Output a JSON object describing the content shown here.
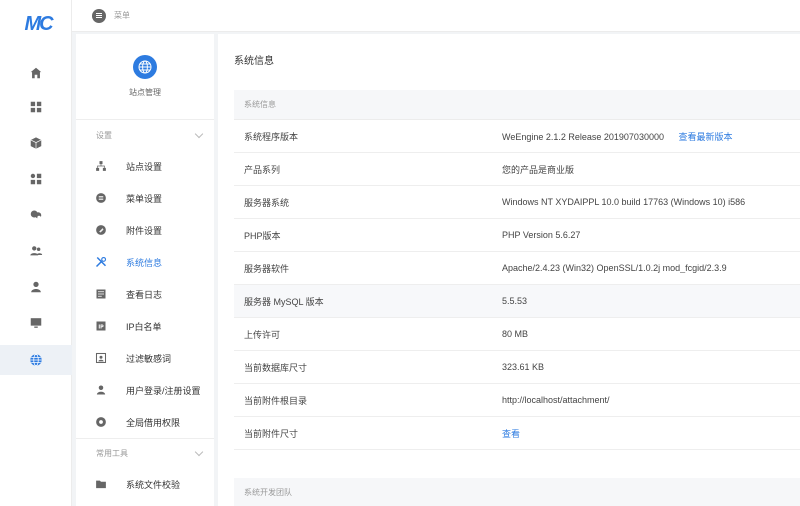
{
  "app": {
    "logo_text": "MC",
    "topbar_label": "菜单"
  },
  "rail": {
    "items": [
      {
        "icon": "home-icon"
      },
      {
        "icon": "grid-icon"
      },
      {
        "icon": "cube-icon"
      },
      {
        "icon": "apps-icon"
      },
      {
        "icon": "cloud-icon"
      },
      {
        "icon": "users-icon"
      },
      {
        "icon": "user-icon"
      },
      {
        "icon": "monitor-icon"
      },
      {
        "icon": "globe-icon",
        "active": true
      }
    ]
  },
  "subnav": {
    "site_title": "站点管理",
    "groups": [
      {
        "title": "设置",
        "items": [
          {
            "label": "站点设置",
            "icon": "sitemap-icon"
          },
          {
            "label": "菜单设置",
            "icon": "menu-circle-icon"
          },
          {
            "label": "附件设置",
            "icon": "paperclip-icon"
          },
          {
            "label": "系统信息",
            "icon": "tools-icon",
            "active": true
          },
          {
            "label": "查看日志",
            "icon": "log-icon"
          },
          {
            "label": "IP白名单",
            "icon": "ip-icon"
          },
          {
            "label": "过滤敏感词",
            "icon": "filter-icon"
          },
          {
            "label": "用户登录/注册设置",
            "icon": "user-icon"
          },
          {
            "label": "全局借用权限",
            "icon": "permission-icon"
          }
        ]
      },
      {
        "title": "常用工具",
        "items": [
          {
            "label": "系统文件校验",
            "icon": "folder-icon"
          }
        ]
      }
    ]
  },
  "main": {
    "page_title": "系统信息",
    "section_title": "系统信息",
    "footer_section_title": "系统开发团队",
    "rows": [
      {
        "key": "系统程序版本",
        "value": "WeEngine 2.1.2 Release 201907030000",
        "link": "查看最新版本"
      },
      {
        "key": "产品系列",
        "value": "您的产品是商业版"
      },
      {
        "key": "服务器系统",
        "value": "Windows NT XYDAIPPL 10.0 build 17763 (Windows 10) i586"
      },
      {
        "key": "PHP版本",
        "value": "PHP Version 5.6.27"
      },
      {
        "key": "服务器软件",
        "value": "Apache/2.4.23 (Win32) OpenSSL/1.0.2j mod_fcgid/2.3.9"
      },
      {
        "key": "服务器 MySQL 版本",
        "value": "5.5.53",
        "shade": true
      },
      {
        "key": "上传许可",
        "value": "80 MB"
      },
      {
        "key": "当前数据库尺寸",
        "value": "323.61 KB"
      },
      {
        "key": "当前附件根目录",
        "value": "http://localhost/attachment/"
      },
      {
        "key": "当前附件尺寸",
        "value": "",
        "link": "查看"
      }
    ]
  },
  "colors": {
    "accent": "#2d7be0",
    "rail_active": "#edf1f6",
    "text": "#444444"
  }
}
